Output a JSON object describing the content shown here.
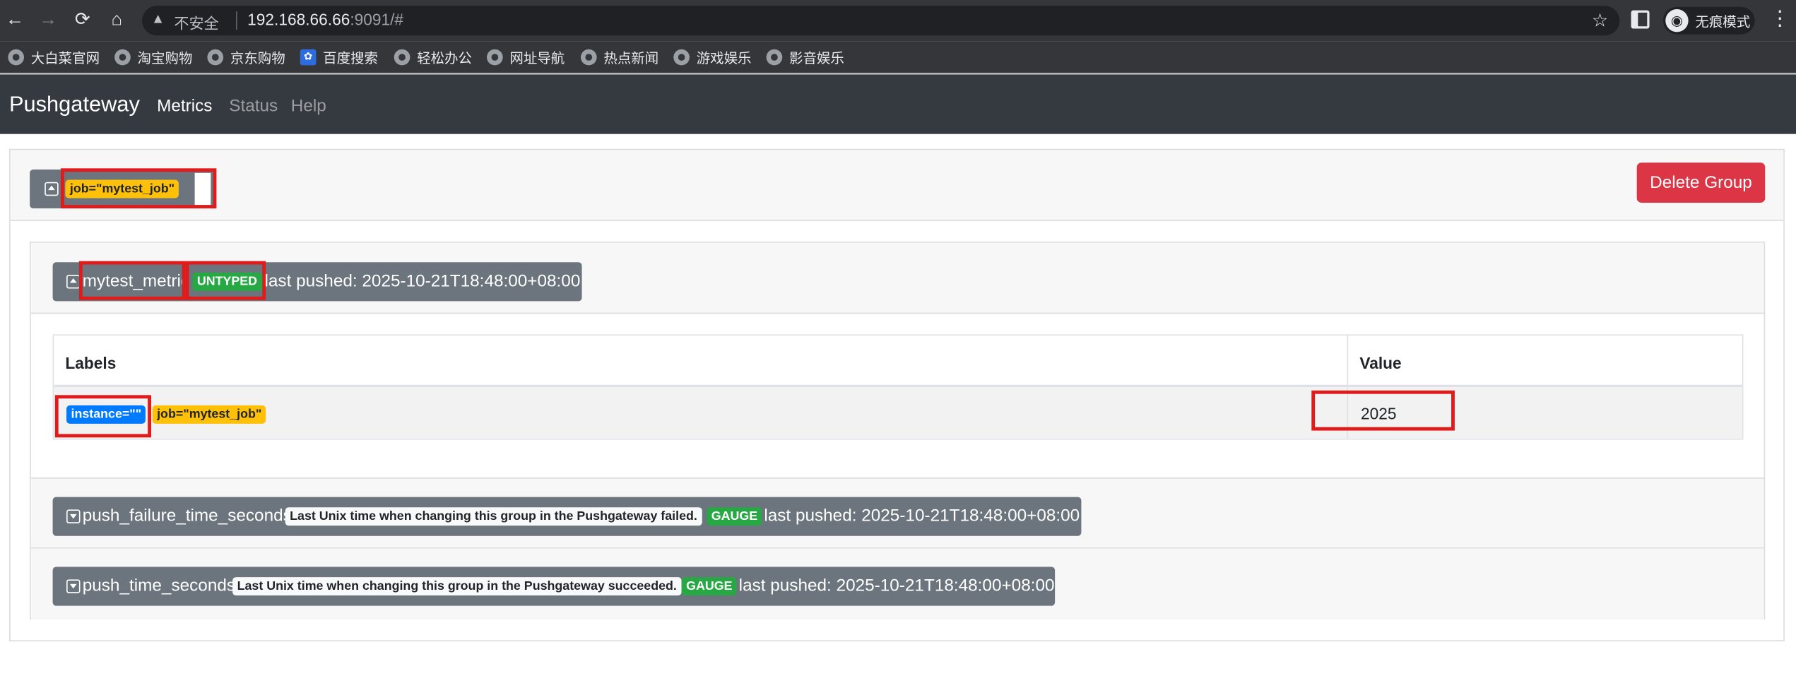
{
  "browser": {
    "nav_back": "←",
    "nav_forward": "→",
    "nav_reload": "⟳",
    "nav_home": "⌂",
    "warn_glyph": "▲",
    "insecure_label": "不安全",
    "url_host": "192.168.66.66",
    "url_path": ":9091/#",
    "star_glyph": "☆",
    "incognito_glyph": "◉",
    "incognito_label": "无痕模式",
    "menu_glyph": "⋮",
    "bookmarks": [
      {
        "label": "大白菜官网",
        "icon": "globe-icon"
      },
      {
        "label": "淘宝购物",
        "icon": "globe-icon"
      },
      {
        "label": "京东购物",
        "icon": "globe-icon"
      },
      {
        "label": "百度搜索",
        "icon": "baidu-paw-icon"
      },
      {
        "label": "轻松办公",
        "icon": "globe-icon"
      },
      {
        "label": "网址导航",
        "icon": "globe-icon"
      },
      {
        "label": "热点新闻",
        "icon": "globe-icon"
      },
      {
        "label": "游戏娱乐",
        "icon": "globe-icon"
      },
      {
        "label": "影音娱乐",
        "icon": "globe-icon"
      }
    ],
    "paw_glyph": "✿"
  },
  "navbar": {
    "brand": "Pushgateway",
    "links": [
      "Metrics",
      "Status",
      "Help"
    ],
    "active": "Metrics"
  },
  "group": {
    "label": "job=\"mytest_job\"",
    "delete_label": "Delete Group"
  },
  "metrics": [
    {
      "name": "mytest_metric",
      "help": "",
      "type": "UNTYPED",
      "last_pushed": "last pushed: 2025-10-21T18:48:00+08:00",
      "expanded": true,
      "table": {
        "headers": [
          "Labels",
          "Value"
        ],
        "rows": [
          {
            "labels": [
              "instance=\"\"",
              "job=\"mytest_job\""
            ],
            "value": "2025"
          }
        ]
      }
    },
    {
      "name": "push_failure_time_seconds",
      "help": "Last Unix time when changing this group in the Pushgateway failed.",
      "type": "GAUGE",
      "last_pushed": "last pushed: 2025-10-21T18:48:00+08:00",
      "expanded": false
    },
    {
      "name": "push_time_seconds",
      "help": "Last Unix time when changing this group in the Pushgateway succeeded.",
      "type": "GAUGE",
      "last_pushed": "last pushed: 2025-10-21T18:48:00+08:00",
      "expanded": false
    }
  ],
  "colors": {
    "navbar": "#343a40",
    "warning": "#ffc107",
    "success": "#28a745",
    "primary": "#007bff",
    "danger": "#dc3545",
    "secondary": "#6c757d",
    "highlight": "#e01b1b"
  }
}
